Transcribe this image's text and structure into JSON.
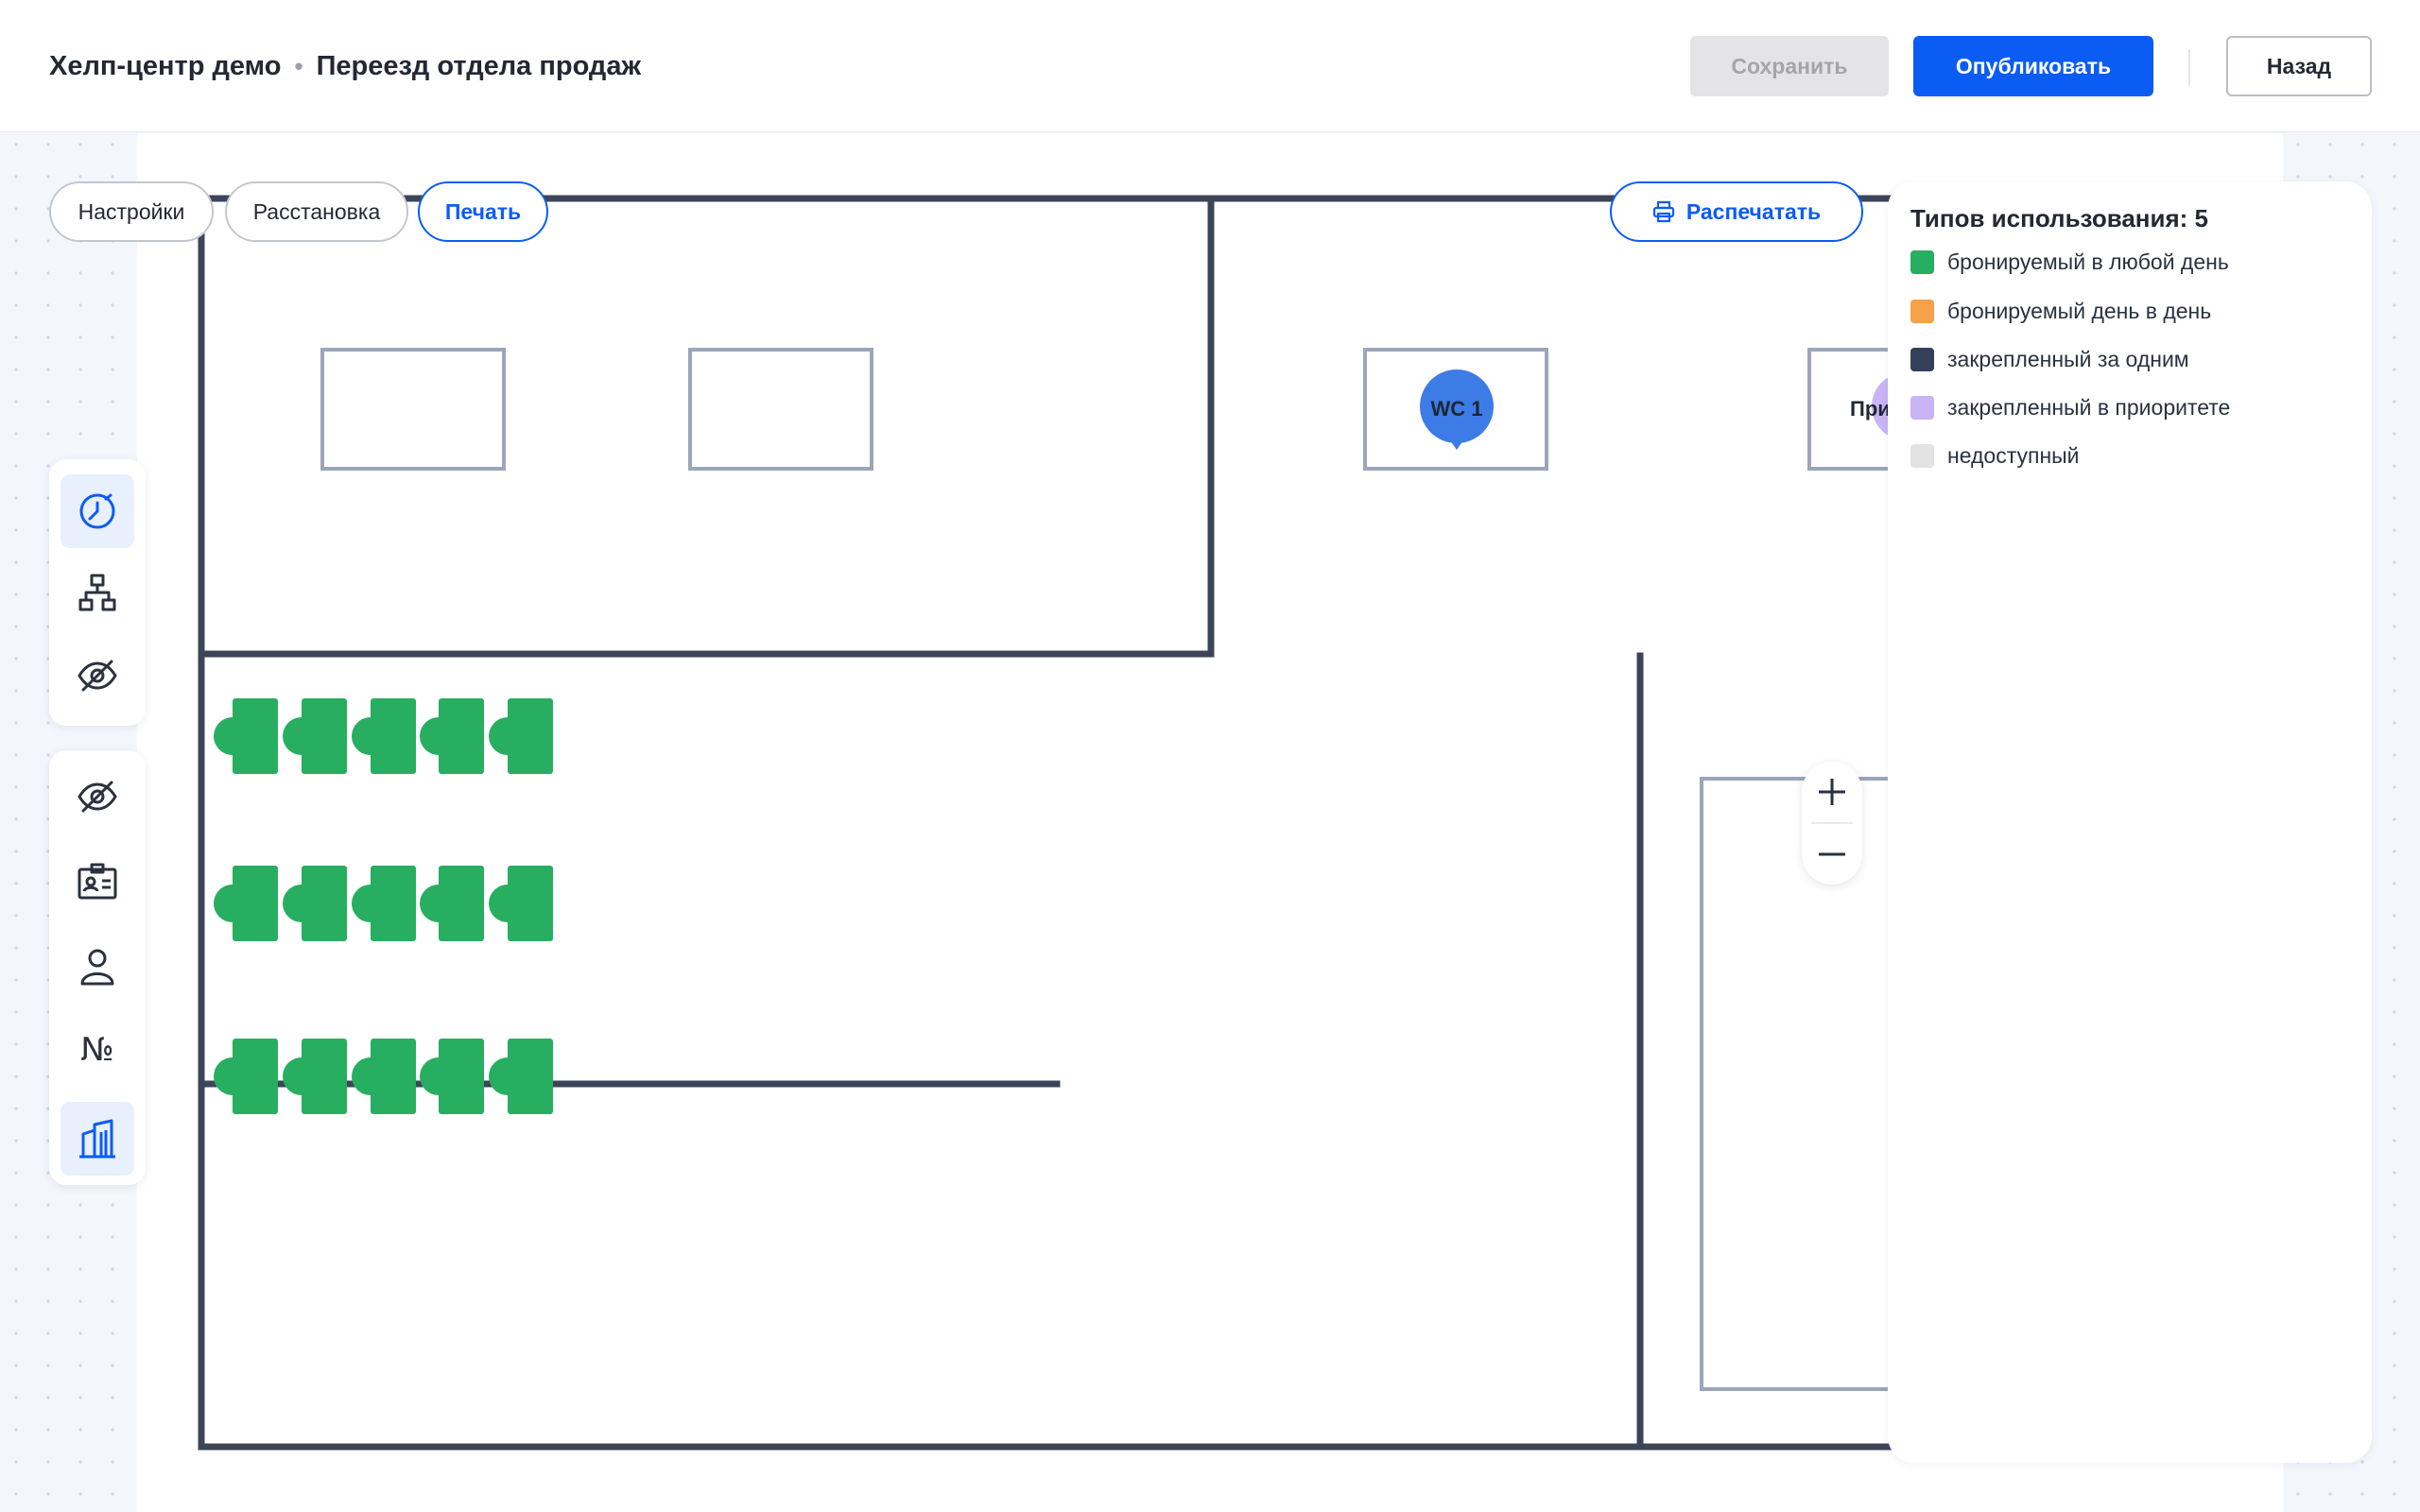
{
  "header": {
    "org": "Хелп-центр демо",
    "separator": "•",
    "project": "Переезд отдела продаж",
    "save_label": "Сохранить",
    "publish_label": "Опубликовать",
    "back_label": "Назад"
  },
  "tabs": [
    {
      "label": "Настройки",
      "active": false
    },
    {
      "label": "Расстановка",
      "active": false
    },
    {
      "label": "Печать",
      "active": true
    }
  ],
  "print_button_label": "Распечатать",
  "toolbar_top": [
    {
      "icon": "clock-icon",
      "active": true
    },
    {
      "icon": "hierarchy-icon",
      "active": false
    },
    {
      "icon": "eye-off-icon",
      "active": false
    }
  ],
  "toolbar_bottom": [
    {
      "icon": "eye-off-icon",
      "active": false
    },
    {
      "icon": "id-badge-icon",
      "active": false
    },
    {
      "icon": "person-icon",
      "active": false
    },
    {
      "icon": "number-icon",
      "active": false,
      "glyph": "№"
    },
    {
      "icon": "building-icon",
      "active": true
    }
  ],
  "map": {
    "markers": [
      {
        "label": "WC 1",
        "color": "#3d7be6"
      },
      {
        "label": "При",
        "color": "#c9b4f5"
      }
    ]
  },
  "legend": {
    "title": "Типов использования: 5",
    "items": [
      {
        "label": "бронируемый в любой день",
        "color": "#27ae60"
      },
      {
        "label": "бронируемый день в день",
        "color": "#f7a14a"
      },
      {
        "label": "закрепленный за одним",
        "color": "#34405a"
      },
      {
        "label": "закрепленный в приоритете",
        "color": "#c9b4f5"
      },
      {
        "label": "недоступный",
        "color": "#e3e3e3"
      }
    ]
  },
  "colors": {
    "accent": "#0b5cf5",
    "wall": "#3c4558",
    "desk": "#27ae60",
    "room_outline": "#9ba6b8"
  }
}
